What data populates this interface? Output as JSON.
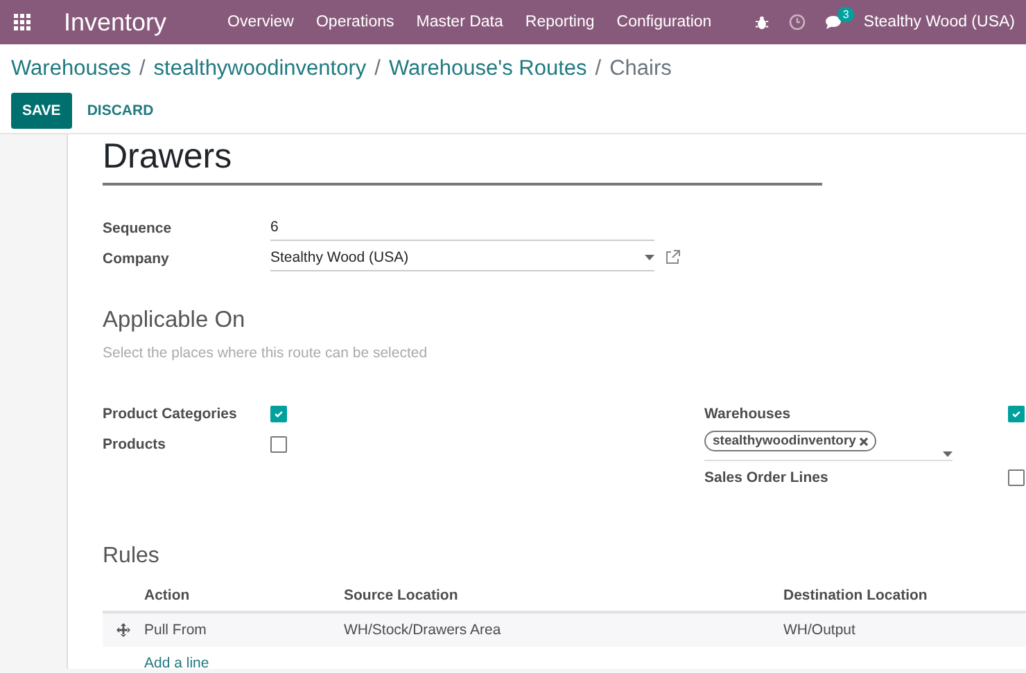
{
  "navbar": {
    "app_title": "Inventory",
    "menu": [
      "Overview",
      "Operations",
      "Master Data",
      "Reporting",
      "Configuration"
    ],
    "messages_count": "3",
    "company": "Stealthy Wood (USA)"
  },
  "breadcrumb": {
    "items": [
      "Warehouses",
      "stealthywoodinventory",
      "Warehouse's Routes"
    ],
    "separator": "/",
    "current": "Chairs"
  },
  "buttons": {
    "save": "SAVE",
    "discard": "DISCARD"
  },
  "form": {
    "name": "Drawers",
    "fields": [
      {
        "label": "Sequence",
        "value": "6",
        "kind": "text"
      },
      {
        "label": "Company",
        "value": "Stealthy Wood (USA)",
        "kind": "many2one"
      }
    ],
    "applicable": {
      "title": "Applicable On",
      "hint": "Select the places where this route can be selected",
      "left": [
        {
          "label": "Product Categories",
          "checked": true
        },
        {
          "label": "Products",
          "checked": false
        }
      ],
      "warehouses": {
        "label": "Warehouses",
        "checked": true,
        "tags": [
          "stealthywoodinventory"
        ]
      },
      "sales_order_lines": {
        "label": "Sales Order Lines",
        "checked": false
      }
    },
    "rules": {
      "title": "Rules",
      "columns": [
        "Action",
        "Source Location",
        "Destination Location"
      ],
      "rows": [
        {
          "action": "Pull From",
          "source": "WH/Stock/Drawers Area",
          "destination": "WH/Output"
        }
      ],
      "add_line": "Add a line"
    }
  }
}
